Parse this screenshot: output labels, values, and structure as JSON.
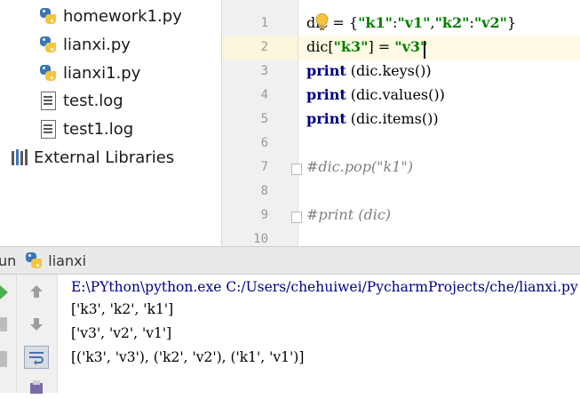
{
  "project_tree": {
    "items": [
      {
        "label": "homework1.py",
        "icon": "python-file-icon"
      },
      {
        "label": "lianxi.py",
        "icon": "python-file-icon"
      },
      {
        "label": "lianxi1.py",
        "icon": "python-file-icon"
      },
      {
        "label": "test.log",
        "icon": "log-file-icon"
      },
      {
        "label": "test1.log",
        "icon": "log-file-icon"
      },
      {
        "label": "External Libraries",
        "icon": "library-icon"
      }
    ]
  },
  "editor": {
    "line_numbers": [
      "1",
      "2",
      "3",
      "4",
      "5",
      "6",
      "7",
      "8",
      "9",
      "10"
    ],
    "current_line": 2,
    "code": {
      "l1_a": "dic = {",
      "l1_k1": "\"k1\"",
      "l1_colon1": ":",
      "l1_v1": "\"v1\"",
      "l1_comma": ",",
      "l1_k2": "\"k2\"",
      "l1_colon2": ":",
      "l1_v2": "\"v2\"",
      "l1_end": "}",
      "l2_a": "dic[",
      "l2_key": "\"k3\"",
      "l2_b": "] = ",
      "l2_val": "\"v3\"",
      "l3_kw": "print",
      "l3_rest": " (dic.keys())",
      "l4_kw": "print",
      "l4_rest": " (dic.values())",
      "l5_kw": "print",
      "l5_rest": " (dic.items())",
      "l7": "#dic.pop(\"k1\")",
      "l9": "#print (dic)"
    },
    "colors": {
      "keyword": "#000080",
      "string": "#008000",
      "comment": "#808080",
      "current_line": "#fffae3"
    }
  },
  "run_panel": {
    "label": "un",
    "config_name": "lianxi",
    "output": [
      "E:\\PYthon\\python.exe C:/Users/chehuiwei/PycharmProjects/che/lianxi.py",
      "['k3', 'k2', 'k1']",
      "['v3', 'v2', 'v1']",
      "[('k3', 'v3'), ('k2', 'v2'), ('k1', 'v1')]"
    ]
  }
}
